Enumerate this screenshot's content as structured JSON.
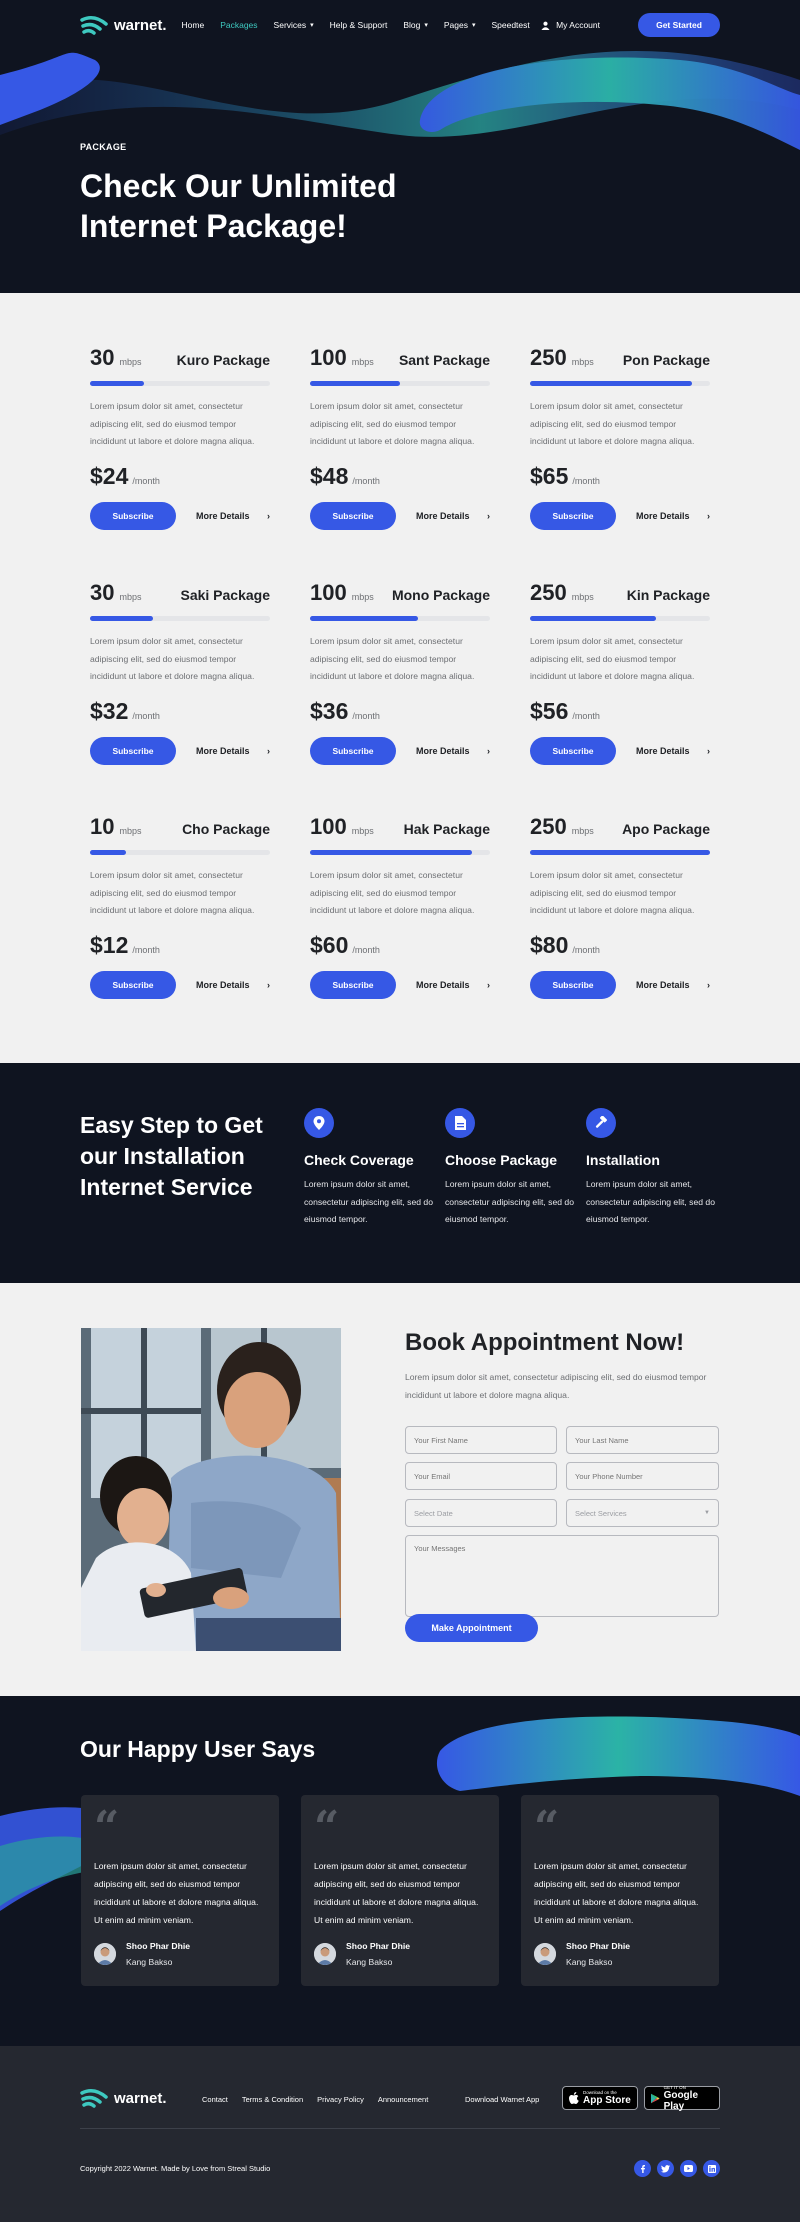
{
  "brand": {
    "name": "warnet.",
    "accent": "#3658e5",
    "teal": "#3ec9c0",
    "dark": "#0f1420"
  },
  "nav": {
    "items": [
      {
        "label": "Home",
        "active": false,
        "dropdown": false
      },
      {
        "label": "Packages",
        "active": true,
        "dropdown": false
      },
      {
        "label": "Services",
        "active": false,
        "dropdown": true
      },
      {
        "label": "Help & Support",
        "active": false,
        "dropdown": false
      },
      {
        "label": "Blog",
        "active": false,
        "dropdown": true
      },
      {
        "label": "Pages",
        "active": false,
        "dropdown": true
      },
      {
        "label": "Speedtest",
        "active": false,
        "dropdown": false
      }
    ],
    "account": "My Account",
    "cta": "Get Started"
  },
  "hero": {
    "label": "PACKAGE",
    "title": "Check Our Unlimited Internet Package!"
  },
  "packages": {
    "description": "Lorem ipsum dolor sit amet, consectetur adipiscing elit, sed do eiusmod tempor incididunt ut labore et dolore magna aliqua.",
    "unit": "mbps",
    "per": "/month",
    "subscribe": "Subscribe",
    "more": "More Details",
    "items": [
      {
        "speed": "30",
        "name": "Kuro Package",
        "price": "$24",
        "level": 0.3
      },
      {
        "speed": "100",
        "name": "Sant Package",
        "price": "$48",
        "level": 0.5
      },
      {
        "speed": "250",
        "name": "Pon Package",
        "price": "$65",
        "level": 0.9
      },
      {
        "speed": "30",
        "name": "Saki Package",
        "price": "$32",
        "level": 0.35
      },
      {
        "speed": "100",
        "name": "Mono Package",
        "price": "$36",
        "level": 0.6
      },
      {
        "speed": "250",
        "name": "Kin Package",
        "price": "$56",
        "level": 0.7
      },
      {
        "speed": "10",
        "name": "Cho Package",
        "price": "$12",
        "level": 0.2
      },
      {
        "speed": "100",
        "name": "Hak Package",
        "price": "$60",
        "level": 0.9
      },
      {
        "speed": "250",
        "name": "Apo Package",
        "price": "$80",
        "level": 1.0
      }
    ]
  },
  "steps": {
    "title": "Easy Step to Get our Installation Internet Service",
    "items": [
      {
        "icon": "location-pin-icon",
        "title": "Check Coverage",
        "text": "Lorem ipsum dolor sit amet, consectetur adipiscing elit, sed do eiusmod tempor."
      },
      {
        "icon": "document-icon",
        "title": "Choose Package",
        "text": "Lorem ipsum dolor sit amet, consectetur adipiscing elit, sed do eiusmod tempor."
      },
      {
        "icon": "hammer-icon",
        "title": "Installation",
        "text": "Lorem ipsum dolor sit amet, consectetur adipiscing elit, sed do eiusmod tempor."
      }
    ]
  },
  "appointment": {
    "title": "Book Appointment Now!",
    "description": "Lorem ipsum dolor sit amet, consectetur adipiscing elit, sed do eiusmod tempor incididunt ut labore et dolore magna aliqua.",
    "first_name": "Your First Name",
    "last_name": "Your Last Name",
    "email": "Your Email",
    "phone": "Your Phone Number",
    "date": "Select Date",
    "services": "Select Services",
    "message": "Your Messages",
    "button": "Make Appointment"
  },
  "testimonials": {
    "title": "Our Happy User Says",
    "items": [
      {
        "text": "Lorem ipsum dolor sit amet, consectetur adipiscing elit, sed do eiusmod tempor incididunt ut labore et dolore magna aliqua. Ut enim ad minim veniam.",
        "name": "Shoo Phar Dhie",
        "location": "Kang Bakso"
      },
      {
        "text": "Lorem ipsum dolor sit amet, consectetur adipiscing elit, sed do eiusmod tempor incididunt ut labore et dolore magna aliqua. Ut enim ad minim veniam.",
        "name": "Shoo Phar Dhie",
        "location": "Kang Bakso"
      },
      {
        "text": "Lorem ipsum dolor sit amet, consectetur adipiscing elit, sed do eiusmod tempor incididunt ut labore et dolore magna aliqua. Ut enim ad minim veniam.",
        "name": "Shoo Phar Dhie",
        "location": "Kang Bakso"
      }
    ]
  },
  "footer": {
    "links": [
      "Contact",
      "Terms & Condition",
      "Privacy Policy",
      "Announcement"
    ],
    "download": "Download Warnet App",
    "appstore_small": "Download on the",
    "appstore": "App Store",
    "googleplay_small": "GET IT ON",
    "googleplay": "Google Play",
    "copyright": "Copyright 2022 Warnet. Made by Love from Streal Studio",
    "socials": [
      "facebook-icon",
      "twitter-icon",
      "youtube-icon",
      "linkedin-icon"
    ]
  }
}
